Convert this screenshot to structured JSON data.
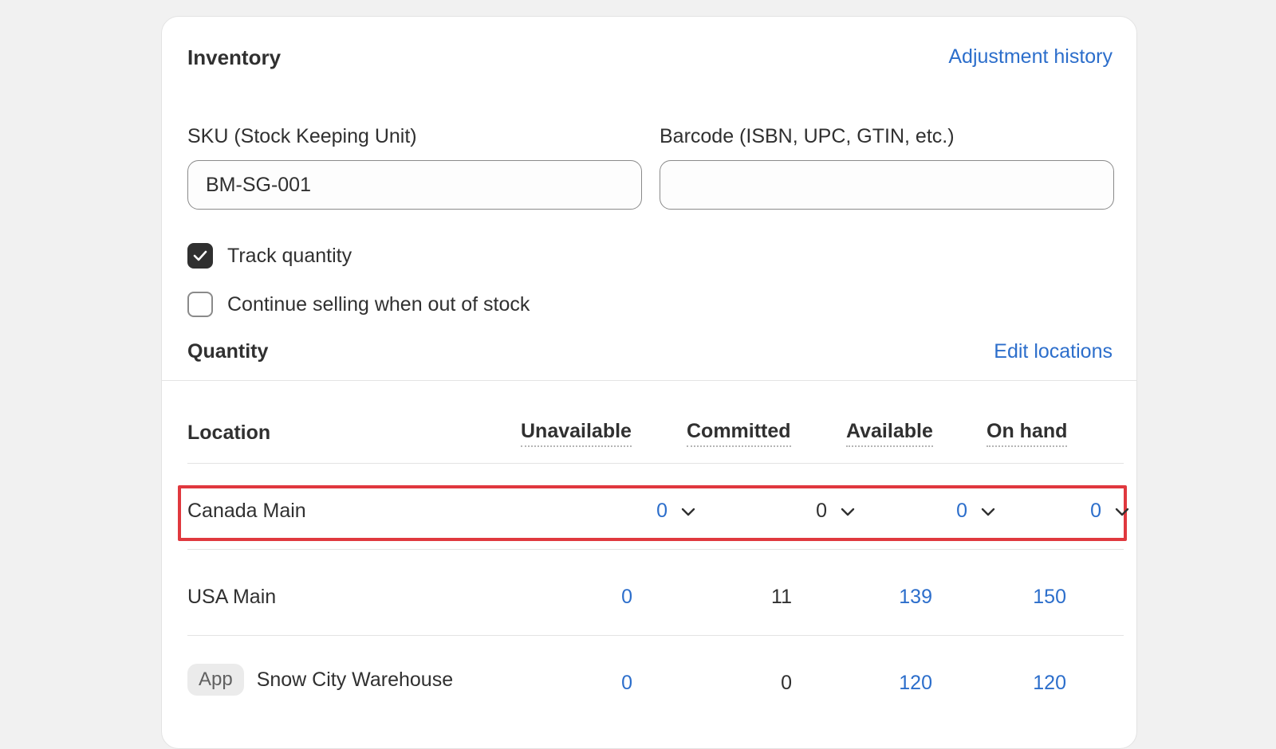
{
  "inventory": {
    "title": "Inventory",
    "adjustment_history": "Adjustment history",
    "sku": {
      "label": "SKU (Stock Keeping Unit)",
      "value": "BM-SG-001"
    },
    "barcode": {
      "label": "Barcode (ISBN, UPC, GTIN, etc.)",
      "value": ""
    },
    "track_quantity": {
      "label": "Track quantity",
      "checked": true
    },
    "continue_selling": {
      "label": "Continue selling when out of stock",
      "checked": false
    }
  },
  "quantity": {
    "title": "Quantity",
    "edit_locations": "Edit locations",
    "columns": {
      "location": "Location",
      "unavailable": "Unavailable",
      "committed": "Committed",
      "available": "Available",
      "on_hand": "On hand"
    },
    "rows": [
      {
        "location": "Canada Main",
        "unavailable": "0",
        "committed": "0",
        "available": "0",
        "on_hand": "0"
      },
      {
        "location": "USA Main",
        "unavailable": "0",
        "committed": "11",
        "available": "139",
        "on_hand": "150"
      },
      {
        "badge": "App",
        "location": "Snow City Warehouse",
        "unavailable": "0",
        "committed": "0",
        "available": "120",
        "on_hand": "120"
      }
    ]
  },
  "colors": {
    "link": "#2c6ecb",
    "highlight": "#e0383e",
    "text": "#303030"
  },
  "icons": [
    "checkmark-icon",
    "chevron-down-icon"
  ]
}
